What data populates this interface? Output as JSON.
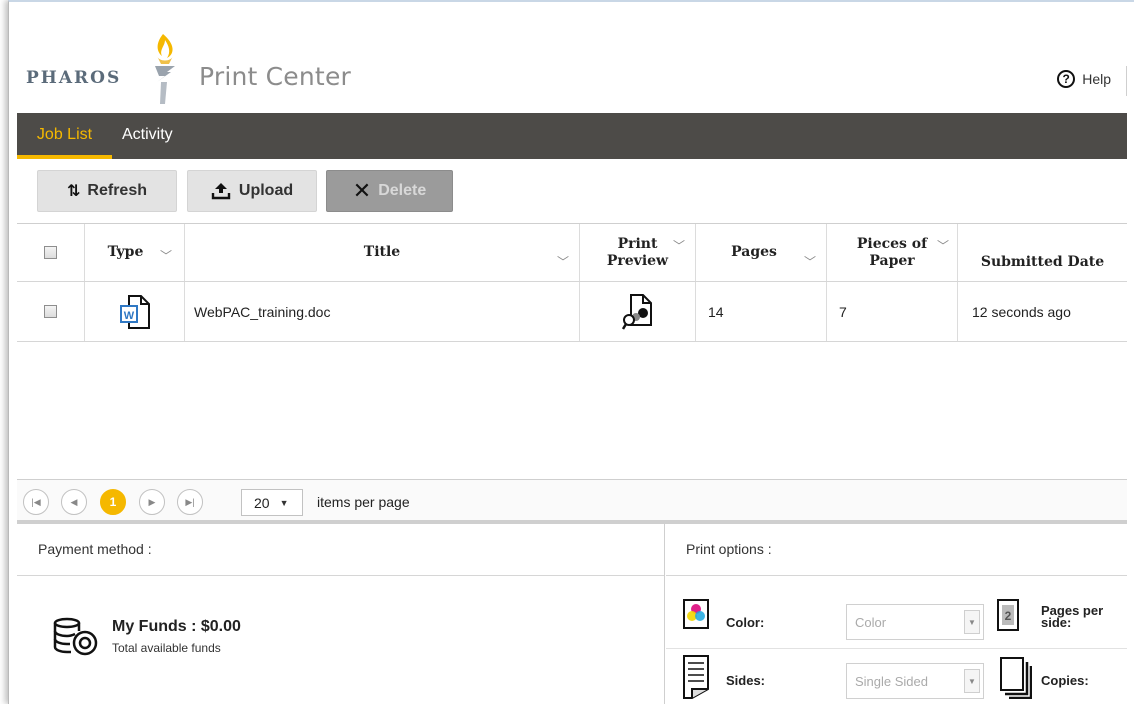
{
  "header": {
    "brand": "PHAROS",
    "product": "Print Center",
    "help_label": "Help"
  },
  "nav": {
    "tabs": [
      {
        "label": "Job List",
        "active": true
      },
      {
        "label": "Activity",
        "active": false
      }
    ]
  },
  "toolbar": {
    "refresh_label": "Refresh",
    "upload_label": "Upload",
    "delete_label": "Delete"
  },
  "grid": {
    "columns": {
      "type": "Type",
      "title": "Title",
      "print_preview_1": "Print",
      "print_preview_2": "Preview",
      "pages": "Pages",
      "pieces_1": "Pieces of",
      "pieces_2": "Paper",
      "submitted": "Submitted Date"
    },
    "rows": [
      {
        "type_icon": "word-document-icon",
        "title": "WebPAC_training.doc",
        "pages": "14",
        "pieces": "7",
        "submitted": "12 seconds ago"
      }
    ]
  },
  "pager": {
    "current_page": "1",
    "per_page": "20",
    "per_page_label": "items per page"
  },
  "payment": {
    "title": "Payment method :",
    "funds_label": "My Funds : $0.00",
    "funds_sub": "Total available funds"
  },
  "print_options": {
    "title": "Print options :",
    "color_label": "Color:",
    "color_value": "Color",
    "sides_label": "Sides:",
    "sides_value": "Single Sided",
    "pages_per_side_label_1": "Pages per",
    "pages_per_side_label_2": "side:",
    "pages_per_side_icon_value": "2",
    "copies_label": "Copies:"
  },
  "colors": {
    "accent": "#f5b800",
    "navbar": "#4d4b48"
  }
}
